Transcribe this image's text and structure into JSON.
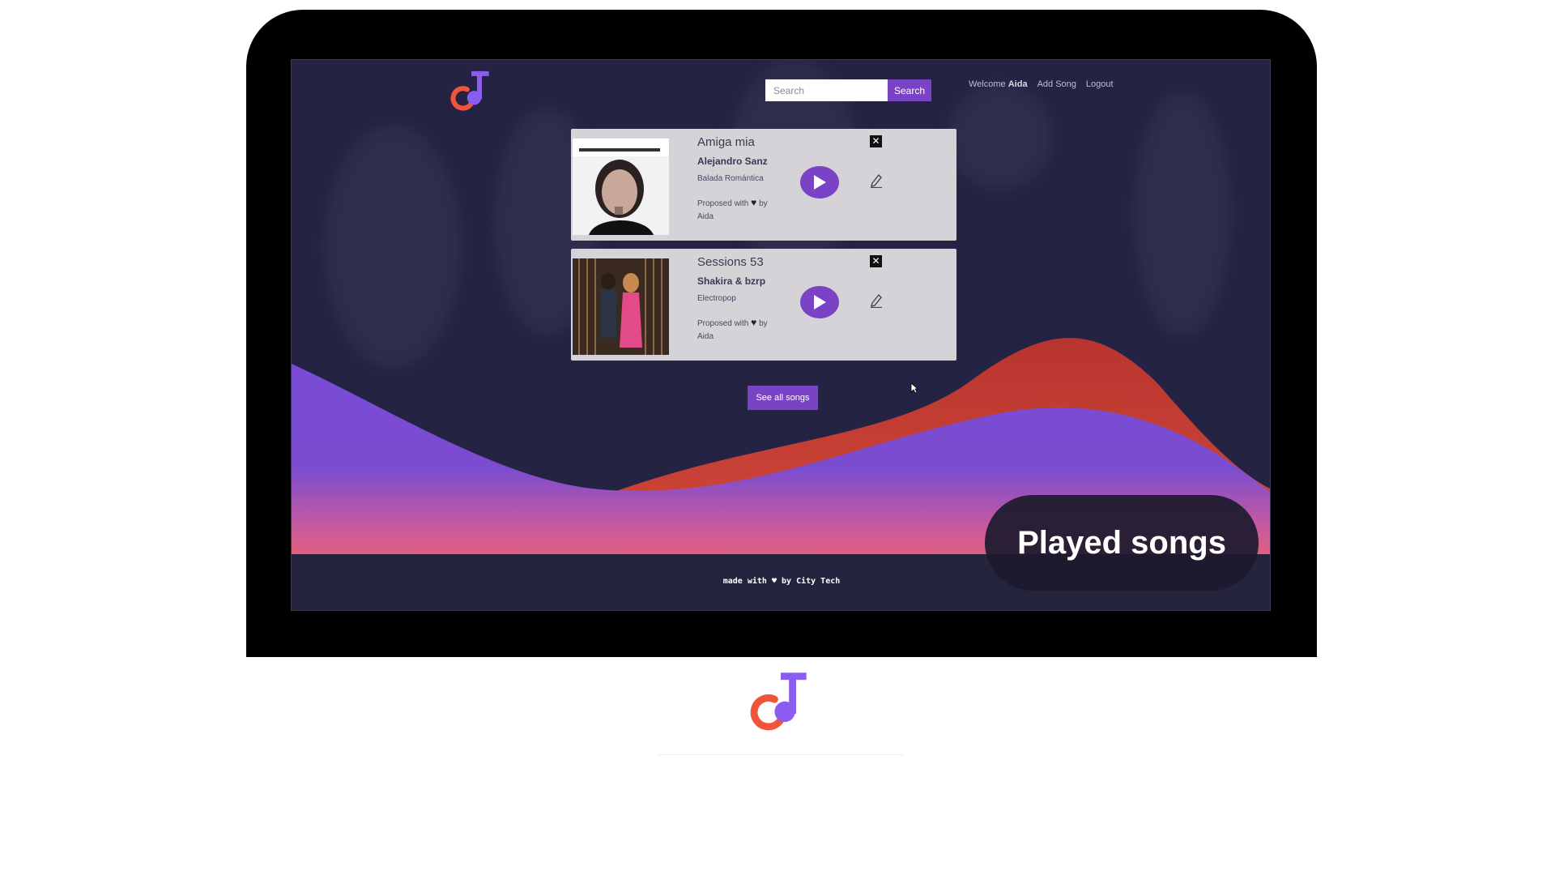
{
  "nav": {
    "search_placeholder": "Search",
    "search_button": "Search",
    "welcome_prefix": "Welcome",
    "user_name": "Aida",
    "add_song": "Add Song",
    "logout": "Logout"
  },
  "songs": [
    {
      "title": "Amiga mia",
      "artist": "Alejandro Sanz",
      "genre": "Balada Romántica",
      "proposed_prefix": "Proposed with",
      "proposed_by": "by",
      "proposer": "Aida"
    },
    {
      "title": "Sessions 53",
      "artist": "Shakira & bzrp",
      "genre": "Electropop",
      "proposed_prefix": "Proposed with",
      "proposed_by": "by",
      "proposer": "Aida"
    }
  ],
  "see_all_button": "See all songs",
  "footer": {
    "prefix": "made with",
    "suffix": "by City Tech"
  },
  "badge": {
    "label": "Played songs"
  },
  "colors": {
    "accent": "#7a43c6",
    "logo_orange": "#f0553a",
    "logo_purple": "#8a5cf0",
    "background": "#242343",
    "card": "#d6d3d8"
  },
  "icons": [
    "music-note-logo-icon",
    "play-icon",
    "close-icon",
    "pencil-icon",
    "heart-icon",
    "mouse-cursor-icon"
  ]
}
